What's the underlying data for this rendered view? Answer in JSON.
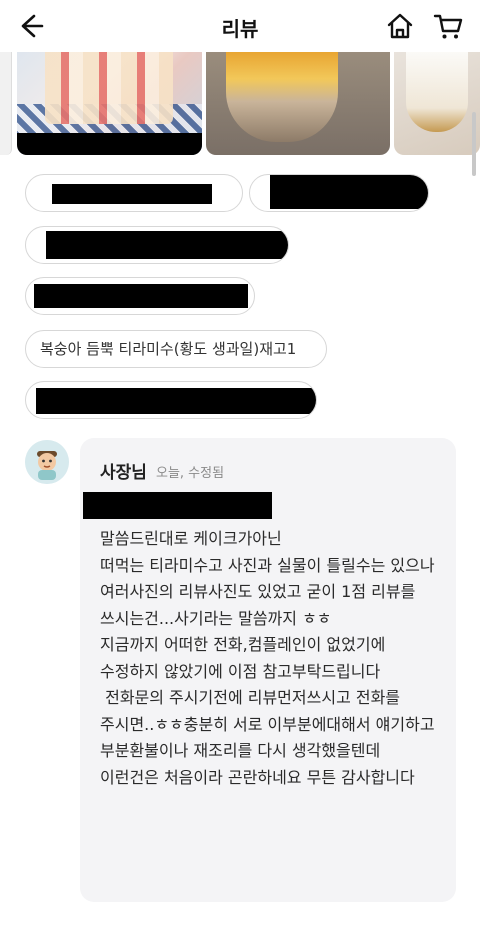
{
  "header": {
    "title": "리뷰",
    "back_icon": "arrow-left-icon",
    "home_icon": "home-icon",
    "cart_icon": "cart-icon"
  },
  "options": [
    {
      "text": "복숭아 듬뿍 티라미수(황도 생과일)재고1"
    }
  ],
  "owner_reply": {
    "name": "사장님",
    "meta": "오늘, 수정됨",
    "body": "말씀드린대로 케이크가아닌\n떠먹는 티라미수고 사진과 실물이 틀릴수는 있으나 여러사진의 리뷰사진도 있었고 굳이 1점 리뷰를 쓰시는건...사기라는 말씀까지 ㅎㅎ\n지금까지 어떠한 전화,컴플레인이 없었기에 수정하지 않았기에 이점 참고부탁드립니다\n 전화문의 주시기전에 리뷰먼저쓰시고 전화를 주시면..ㅎㅎ충분히 서로 이부분에대해서 얘기하고 부분환불이나 재조리를 다시 생각했을텐데\n이런건은 처음이라 곤란하네요 무튼 감사합니다"
  }
}
